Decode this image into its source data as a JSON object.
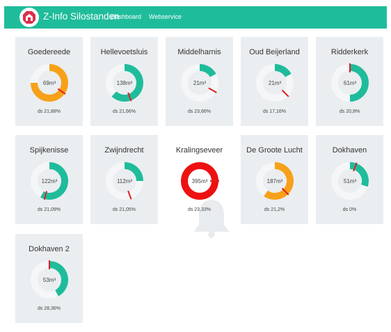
{
  "app": {
    "title": "Z-Info Silostanden"
  },
  "nav": {
    "dashboard": "Dashboard",
    "webservice": "Webservice"
  },
  "colors": {
    "teal": "#1fbc9c",
    "orange": "#f7a11a",
    "red": "#ee1111",
    "track": "#f4f6f7",
    "needle": "#e01e1e"
  },
  "cards": [
    {
      "name": "Goedereede",
      "value": "69m³",
      "ds": "ds 21,88%",
      "fill": 0.75,
      "color": "orange",
      "needle": 125
    },
    {
      "name": "Hellevoetsluis",
      "value": "138m³",
      "ds": "ds 21,66%",
      "fill": 0.62,
      "color": "teal",
      "needle": 160
    },
    {
      "name": "Middelharnis",
      "value": "21m³",
      "ds": "ds 23,66%",
      "fill": 0.17,
      "color": "teal",
      "needle": 120
    },
    {
      "name": "Oud Beijerland",
      "value": "21m³",
      "ds": "ds 17,16%",
      "fill": 0.17,
      "color": "teal",
      "needle": 135
    },
    {
      "name": "Ridderkerk",
      "value": "61m³",
      "ds": "ds 20,8%",
      "fill": 0.5,
      "color": "teal",
      "needle": 0
    },
    {
      "name": "Spijkenisse",
      "value": "122m³",
      "ds": "ds 21,09%",
      "fill": 0.58,
      "color": "teal",
      "needle": 195
    },
    {
      "name": "Zwijndrecht",
      "value": "112m³",
      "ds": "ds 21,05%",
      "fill": 0.25,
      "color": "teal",
      "needle": 160
    },
    {
      "name": "Kralingseveer",
      "value": "395m³",
      "ds": "ds 23,33%",
      "fill": 1.0,
      "color": "red",
      "needle": 90
    },
    {
      "name": "De Groote Lucht",
      "value": "187m³",
      "ds": "ds 21,2%",
      "fill": 0.6,
      "color": "orange",
      "needle": 135
    },
    {
      "name": "Dokhaven",
      "value": "51m³",
      "ds": "ds 0%",
      "fill": 0.3,
      "color": "teal",
      "needle": 20
    },
    {
      "name": "Dokhaven 2",
      "value": "53m³",
      "ds": "ds 28,36%",
      "fill": 0.42,
      "color": "teal",
      "needle": 0
    }
  ]
}
